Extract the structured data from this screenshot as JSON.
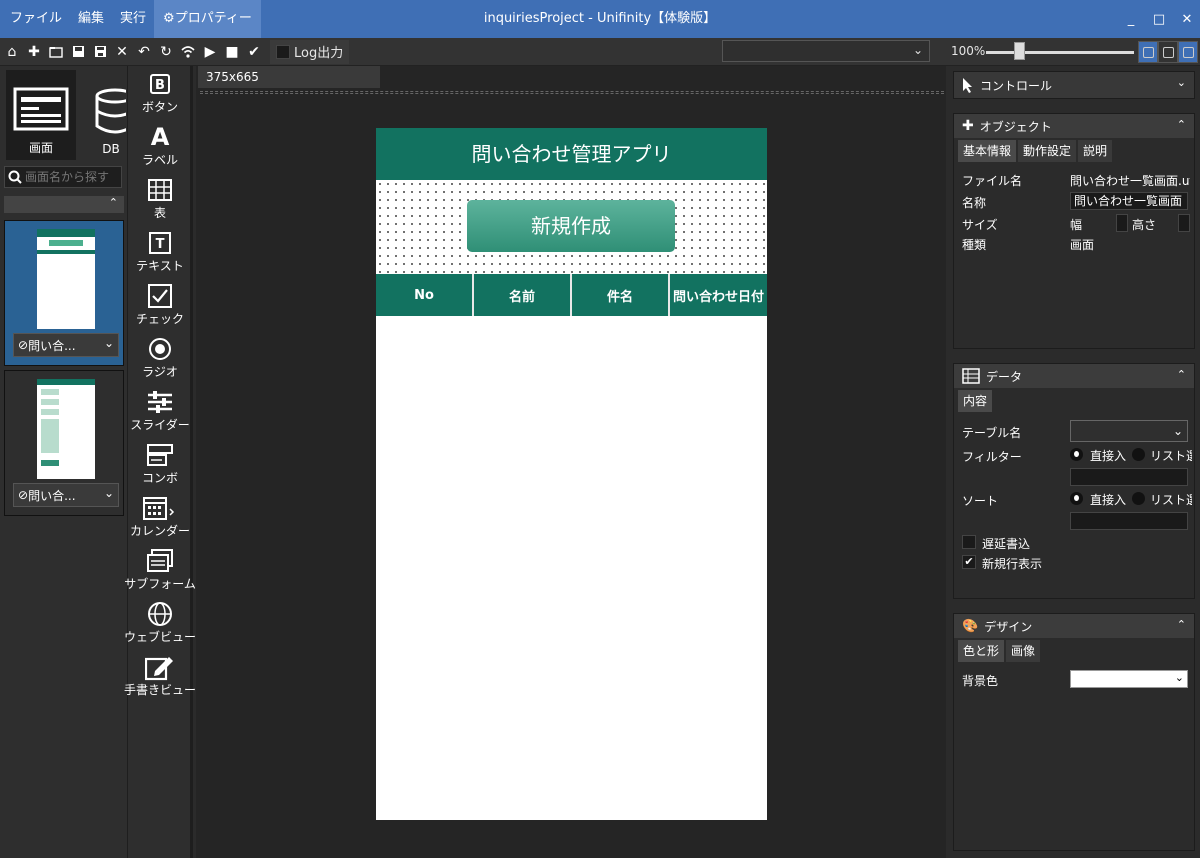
{
  "menu": [
    "ファイル",
    "編集",
    "実行",
    "プロパティー"
  ],
  "window_title": "inquiriesProject - Unifinity【体験版】",
  "window_controls": {
    "minimize": "_",
    "maximize": "□",
    "close": "✕"
  },
  "toolbar": {
    "log_label": "Log出力",
    "zoom": "100%"
  },
  "left": {
    "mode_screen": "画面",
    "mode_db": "DB",
    "search_placeholder": "画面名から探す",
    "thumbs": [
      {
        "label": "問い合..."
      },
      {
        "label": "問い合..."
      }
    ]
  },
  "palette": [
    "ボタン",
    "ラベル",
    "表",
    "テキスト",
    "チェック",
    "ラジオ",
    "スライダー",
    "コンボ",
    "カレンダー",
    "サブフォーム",
    "ウェブビュー",
    "手書きビュー"
  ],
  "editor": {
    "tab": "375x665",
    "app_title": "問い合わせ管理アプリ",
    "new_button": "新規作成",
    "columns": [
      "No",
      "名前",
      "件名",
      "問い合わせ日付"
    ]
  },
  "control_panel": {
    "title": "コントロール"
  },
  "object_panel": {
    "title": "オブジェクト",
    "tabs": [
      "基本情報",
      "動作設定",
      "説明"
    ],
    "rows": {
      "file_label": "ファイル名",
      "file_value": "問い合わせ一覧画面.uf",
      "name_label": "名称",
      "name_value": "問い合わせ一覧画面",
      "size_label": "サイズ",
      "width_label": "幅",
      "height_label": "高さ",
      "type_label": "種類",
      "type_value": "画面"
    }
  },
  "data_panel": {
    "title": "データ",
    "tab": "内容",
    "table_label": "テーブル名",
    "filter_label": "フィルター",
    "sort_label": "ソート",
    "direct": "直接入",
    "list": "リスト選",
    "delay_label": "遅延書込",
    "newrow_label": "新規行表示"
  },
  "design_panel": {
    "title": "デザイン",
    "tabs": [
      "色と形",
      "画像"
    ],
    "bg_label": "背景色"
  }
}
